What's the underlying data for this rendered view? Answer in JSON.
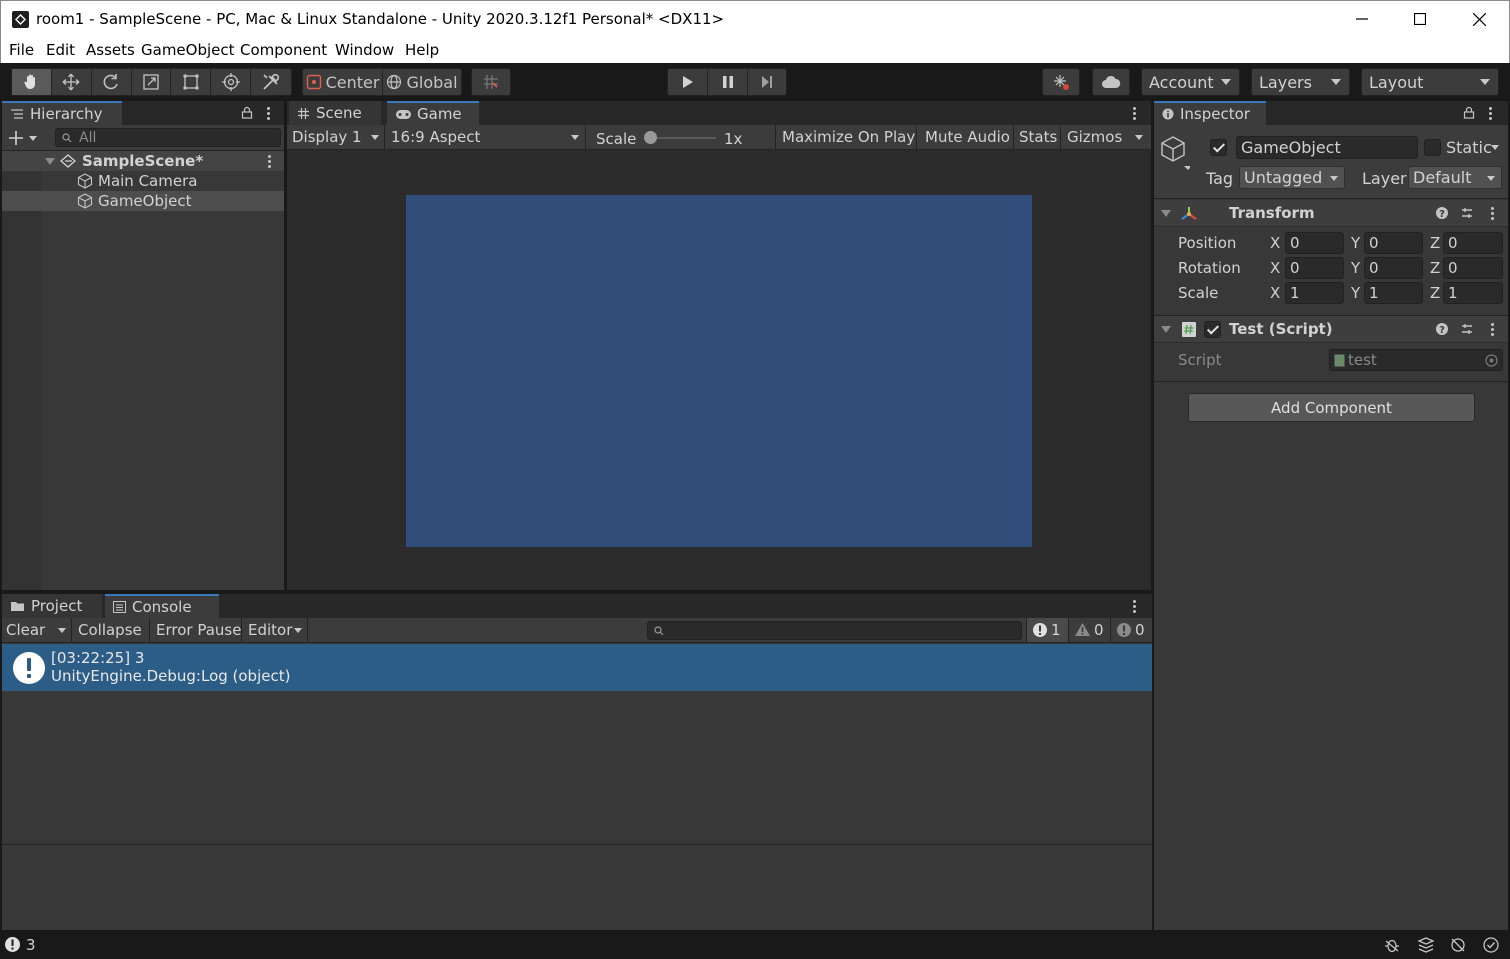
{
  "window": {
    "title": "room1 - SampleScene - PC, Mac & Linux Standalone - Unity 2020.3.12f1 Personal* <DX11>"
  },
  "menu": [
    "File",
    "Edit",
    "Assets",
    "GameObject",
    "Component",
    "Window",
    "Help"
  ],
  "toolbar": {
    "pivot_label": "Center",
    "space_label": "Global",
    "account_label": "Account",
    "layers_label": "Layers",
    "layout_label": "Layout"
  },
  "hierarchy": {
    "tab_label": "Hierarchy",
    "search_placeholder": "All",
    "scene_name": "SampleScene*",
    "items": [
      "Main Camera",
      "GameObject"
    ],
    "selected_index": 1
  },
  "game_view": {
    "tabs": [
      "Scene",
      "Game"
    ],
    "active_tab": "Game",
    "display": "Display 1",
    "aspect": "16:9 Aspect",
    "scale_label": "Scale",
    "scale_value": "1x",
    "maximize_label": "Maximize On Play",
    "mute_label": "Mute Audio",
    "stats_label": "Stats",
    "gizmos_label": "Gizmos",
    "background_color": "#314d79"
  },
  "inspector": {
    "tab_label": "Inspector",
    "object_name": "GameObject",
    "active": true,
    "static_label": "Static",
    "tag_label": "Tag",
    "tag_value": "Untagged",
    "layer_label": "Layer",
    "layer_value": "Default",
    "transform": {
      "title": "Transform",
      "rows": [
        {
          "label": "Position",
          "x": "0",
          "y": "0",
          "z": "0"
        },
        {
          "label": "Rotation",
          "x": "0",
          "y": "0",
          "z": "0"
        },
        {
          "label": "Scale",
          "x": "1",
          "y": "1",
          "z": "1"
        }
      ],
      "axis_x": "X",
      "axis_y": "Y",
      "axis_z": "Z"
    },
    "script_component": {
      "title": "Test (Script)",
      "enabled": true,
      "script_label": "Script",
      "script_value": "test"
    },
    "add_component_label": "Add Component"
  },
  "console": {
    "tabs": [
      "Project",
      "Console"
    ],
    "active_tab": "Console",
    "clear_label": "Clear",
    "collapse_label": "Collapse",
    "error_pause_label": "Error Pause",
    "editor_label": "Editor",
    "log_count": "1",
    "warning_count": "0",
    "error_count": "0",
    "entries": [
      {
        "line1": "[03:22:25] 3",
        "line2": "UnityEngine.Debug:Log (object)"
      }
    ],
    "selection_color": "#2c5d87"
  },
  "statusbar": {
    "message": "3"
  }
}
